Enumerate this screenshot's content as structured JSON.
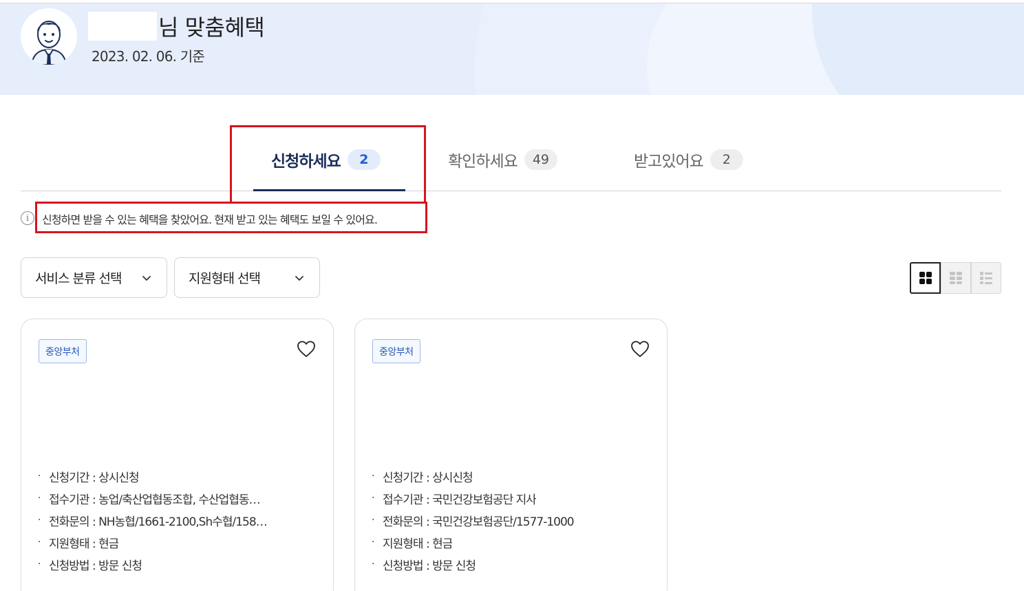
{
  "header": {
    "title_suffix": "님 맞춤혜택",
    "date": "2023. 02. 06. 기준"
  },
  "tabs": [
    {
      "label": "신청하세요",
      "count": "2",
      "active": true
    },
    {
      "label": "확인하세요",
      "count": "49",
      "active": false
    },
    {
      "label": "받고있어요",
      "count": "2",
      "active": false
    }
  ],
  "notice": {
    "icon": "info-icon",
    "text": "신청하면 받을 수 있는 혜택을 찾았어요. 현재 받고 있는 혜택도 보일 수 있어요."
  },
  "filters": {
    "service_category": "서비스 분류 선택",
    "support_type": "지원형태 선택"
  },
  "view_modes": [
    "grid-view-icon",
    "card-list-view-icon",
    "list-view-icon"
  ],
  "cards": [
    {
      "badge": "중앙부처",
      "details": [
        {
          "label": "신청기간 : 상시신청"
        },
        {
          "label": "접수기관 : 농업/축산업협동조합, 수산업협동…"
        },
        {
          "label": "전화문의 : NH농협/1661-2100,Sh수협/158…"
        },
        {
          "label": "지원형태 : 현금"
        },
        {
          "label": "신청방법 : 방문 신청"
        }
      ]
    },
    {
      "badge": "중앙부처",
      "details": [
        {
          "label": "신청기간 : 상시신청"
        },
        {
          "label": "접수기관 : 국민건강보험공단 지사"
        },
        {
          "label": "전화문의 : 국민건강보험공단/1577-1000"
        },
        {
          "label": "지원형태 : 현금"
        },
        {
          "label": "신청방법 : 방문 신청"
        }
      ]
    }
  ],
  "colors": {
    "banner_bg": "#e6eefc",
    "active_tab": "#1a2d5a",
    "highlight": "#d5141f",
    "badge_text": "#2858b5"
  }
}
